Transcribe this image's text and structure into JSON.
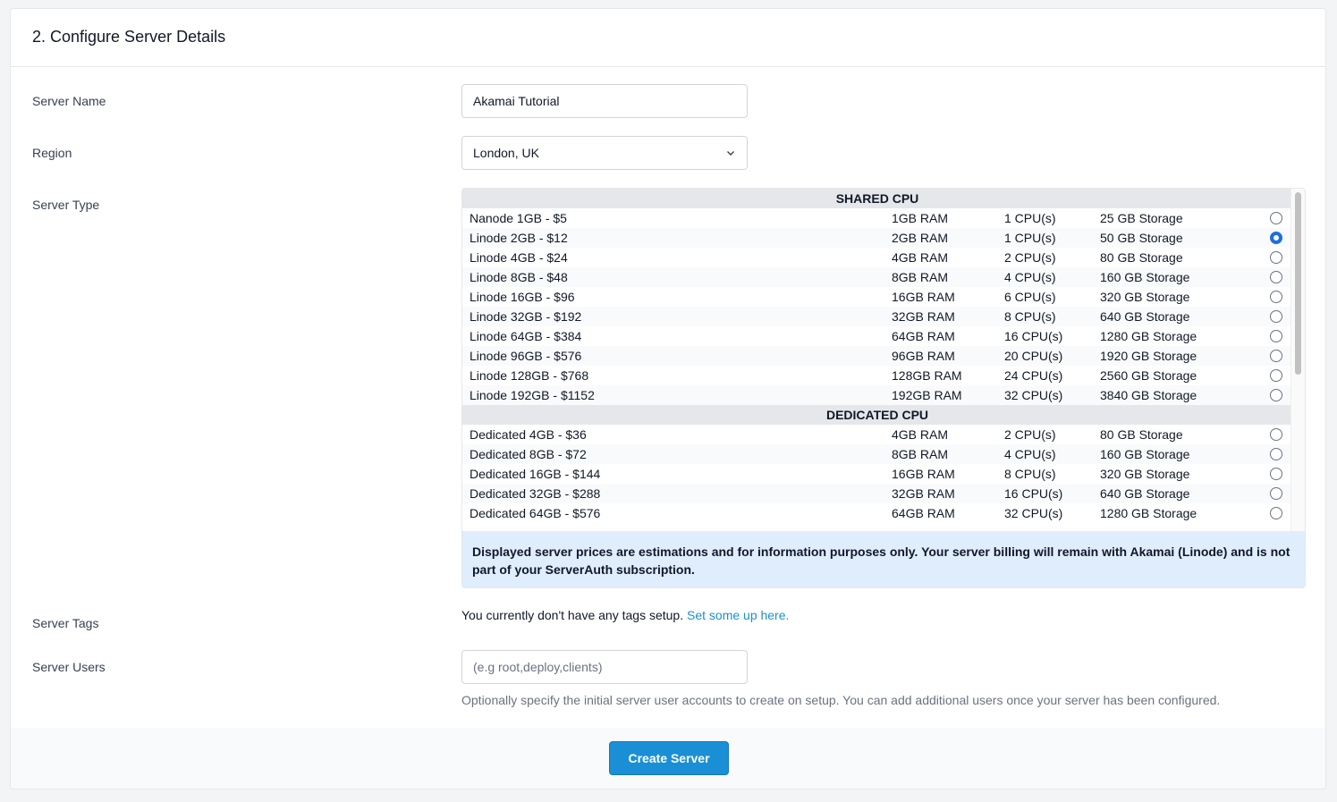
{
  "header": {
    "title": "2. Configure Server Details"
  },
  "fields": {
    "server_name": {
      "label": "Server Name",
      "value": "Akamai Tutorial"
    },
    "region": {
      "label": "Region",
      "value": "London, UK"
    },
    "server_type": {
      "label": "Server Type"
    },
    "server_tags": {
      "label": "Server Tags",
      "text": "You currently don't have any tags setup.",
      "link": "Set some up here."
    },
    "server_users": {
      "label": "Server Users",
      "placeholder": "(e.g root,deploy,clients)",
      "help": "Optionally specify the initial server user accounts to create on setup. You can add additional users once your server has been configured."
    }
  },
  "server_types": {
    "groups": [
      {
        "title": "SHARED CPU",
        "rows": [
          {
            "name": "Nanode 1GB - $5",
            "ram": "1GB RAM",
            "cpu": "1 CPU(s)",
            "storage": "25 GB Storage",
            "selected": false
          },
          {
            "name": "Linode 2GB - $12",
            "ram": "2GB RAM",
            "cpu": "1 CPU(s)",
            "storage": "50 GB Storage",
            "selected": true
          },
          {
            "name": "Linode 4GB - $24",
            "ram": "4GB RAM",
            "cpu": "2 CPU(s)",
            "storage": "80 GB Storage",
            "selected": false
          },
          {
            "name": "Linode 8GB - $48",
            "ram": "8GB RAM",
            "cpu": "4 CPU(s)",
            "storage": "160 GB Storage",
            "selected": false
          },
          {
            "name": "Linode 16GB - $96",
            "ram": "16GB RAM",
            "cpu": "6 CPU(s)",
            "storage": "320 GB Storage",
            "selected": false
          },
          {
            "name": "Linode 32GB - $192",
            "ram": "32GB RAM",
            "cpu": "8 CPU(s)",
            "storage": "640 GB Storage",
            "selected": false
          },
          {
            "name": "Linode 64GB - $384",
            "ram": "64GB RAM",
            "cpu": "16 CPU(s)",
            "storage": "1280 GB Storage",
            "selected": false
          },
          {
            "name": "Linode 96GB - $576",
            "ram": "96GB RAM",
            "cpu": "20 CPU(s)",
            "storage": "1920 GB Storage",
            "selected": false
          },
          {
            "name": "Linode 128GB - $768",
            "ram": "128GB RAM",
            "cpu": "24 CPU(s)",
            "storage": "2560 GB Storage",
            "selected": false
          },
          {
            "name": "Linode 192GB - $1152",
            "ram": "192GB RAM",
            "cpu": "32 CPU(s)",
            "storage": "3840 GB Storage",
            "selected": false
          }
        ]
      },
      {
        "title": "DEDICATED CPU",
        "rows": [
          {
            "name": "Dedicated 4GB - $36",
            "ram": "4GB RAM",
            "cpu": "2 CPU(s)",
            "storage": "80 GB Storage",
            "selected": false
          },
          {
            "name": "Dedicated 8GB - $72",
            "ram": "8GB RAM",
            "cpu": "4 CPU(s)",
            "storage": "160 GB Storage",
            "selected": false
          },
          {
            "name": "Dedicated 16GB - $144",
            "ram": "16GB RAM",
            "cpu": "8 CPU(s)",
            "storage": "320 GB Storage",
            "selected": false
          },
          {
            "name": "Dedicated 32GB - $288",
            "ram": "32GB RAM",
            "cpu": "16 CPU(s)",
            "storage": "640 GB Storage",
            "selected": false
          },
          {
            "name": "Dedicated 64GB - $576",
            "ram": "64GB RAM",
            "cpu": "32 CPU(s)",
            "storage": "1280 GB Storage",
            "selected": false
          }
        ]
      }
    ],
    "notice": "Displayed server prices are estimations and for information purposes only. Your server billing will remain with Akamai (Linode) and is not part of your ServerAuth subscription."
  },
  "footer": {
    "submit_label": "Create Server"
  },
  "colors": {
    "accent": "#1a8fd6",
    "radio_selected": "#1d6fe0",
    "notice_bg": "#e0edfc"
  }
}
